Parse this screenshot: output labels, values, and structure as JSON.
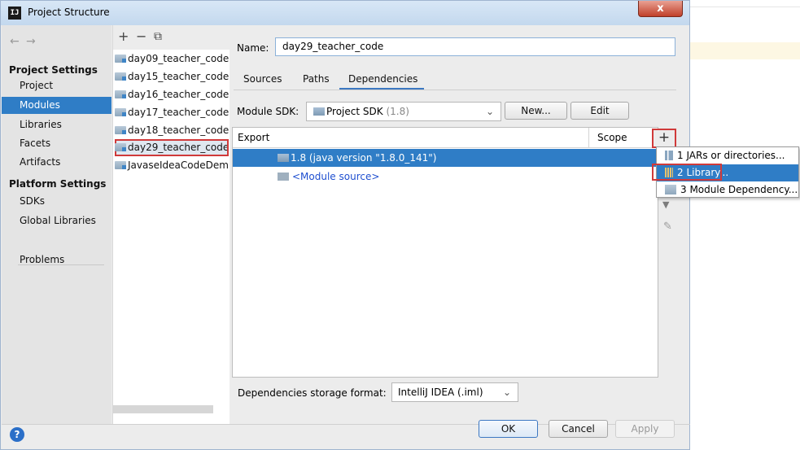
{
  "window": {
    "title": "Project Structure",
    "close_glyph": "x",
    "icon_label": "IJ"
  },
  "nav": {
    "back": "←",
    "forward": "→",
    "project_settings_heading": "Project Settings",
    "project_settings": [
      "Project",
      "Modules",
      "Libraries",
      "Facets",
      "Artifacts"
    ],
    "platform_settings_heading": "Platform Settings",
    "platform_settings": [
      "SDKs",
      "Global Libraries"
    ],
    "problems": "Problems",
    "selected": "Modules"
  },
  "module_toolbar": {
    "add": "+",
    "remove": "−",
    "copy": "⧉"
  },
  "modules": [
    "day09_teacher_code",
    "day15_teacher_code",
    "day16_teacher_code",
    "day17_teacher_code",
    "day18_teacher_code",
    "day29_teacher_code",
    "JavaseIdeaCodeDemo"
  ],
  "selected_module": "day29_teacher_code",
  "detail": {
    "name_label": "Name:",
    "name_value": "day29_teacher_code",
    "tabs": [
      "Sources",
      "Paths",
      "Dependencies"
    ],
    "active_tab": "Dependencies",
    "sdk_label": "Module SDK:",
    "sdk_value": "Project SDK",
    "sdk_version": "(1.8)",
    "new_button": "New...",
    "edit_button": "Edit",
    "table": {
      "col_export": "Export",
      "col_scope": "Scope",
      "rows": [
        "1.8 (java version \"1.8.0_141\")",
        "<Module source>"
      ]
    },
    "add_glyph": "+",
    "storage_label": "Dependencies storage format:",
    "storage_value": "IntelliJ IDEA (.iml)"
  },
  "popup": {
    "items": [
      "1  JARs or directories...",
      "2  Library...",
      "3  Module Dependency..."
    ],
    "selected_index": 1
  },
  "footer": {
    "help": "?",
    "ok": "OK",
    "cancel": "Cancel",
    "apply": "Apply"
  },
  "colors": {
    "selection": "#2f7dc6",
    "highlight_box": "#d03a3a",
    "link_text": "#1f4fd0"
  }
}
